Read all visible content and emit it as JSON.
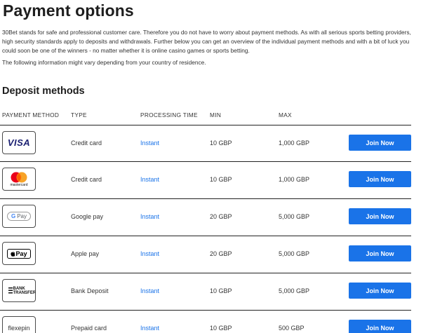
{
  "page": {
    "title": "Payment options",
    "intro": "30Bet stands for safe and professional customer care. Therefore you do not have to worry about payment methods. As with all serious sports betting providers, high security standards apply to deposits and withdrawals. Further below you can get an overview of the individual payment methods and with a bit of luck you could soon be one of the winners - no matter whether it is online casino games or sports betting.",
    "note": "The following information might vary depending from your country of residence."
  },
  "deposit": {
    "section_title": "Deposit methods",
    "headers": [
      "PAYMENT METHOD",
      "TYPE",
      "PROCESSING TIME",
      "MIN",
      "MAX"
    ],
    "rows": [
      {
        "logo": "VISA",
        "logo_icon": "visa-logo-icon",
        "type": "Credit card",
        "processing": "Instant",
        "min": "10 GBP",
        "max": "1,000 GBP",
        "button": "Join Now"
      },
      {
        "logo": "mastercard",
        "logo_icon": "mastercard-logo-icon",
        "type": "Credit card",
        "processing": "Instant",
        "min": "10 GBP",
        "max": "1,000 GBP",
        "button": "Join Now"
      },
      {
        "logo": "G Pay",
        "logo_icon": "google-pay-logo-icon",
        "type": "Google pay",
        "processing": "Instant",
        "min": "20 GBP",
        "max": "5,000 GBP",
        "button": "Join Now"
      },
      {
        "logo": "Pay",
        "logo_icon": "apple-pay-logo-icon",
        "type": "Apple pay",
        "processing": "Instant",
        "min": "20 GBP",
        "max": "5,000 GBP",
        "button": "Join Now"
      },
      {
        "logo": "BANK TRANSFER",
        "logo_icon": "bank-transfer-logo-icon",
        "type": "Bank Deposit",
        "processing": "Instant",
        "min": "10 GBP",
        "max": "5,000 GBP",
        "button": "Join Now"
      },
      {
        "logo": "flexepin",
        "logo_icon": "flexepin-logo-icon",
        "type": "Prepaid card",
        "processing": "Instant",
        "min": "10 GBP",
        "max": "500 GBP",
        "button": "Join Now"
      }
    ]
  },
  "colors": {
    "accent": "#1a73e8",
    "text": "#1e1e1e",
    "mastercard_red": "#eb001b",
    "mastercard_orange": "#f79e1b",
    "visa_blue": "#1a1f71"
  }
}
